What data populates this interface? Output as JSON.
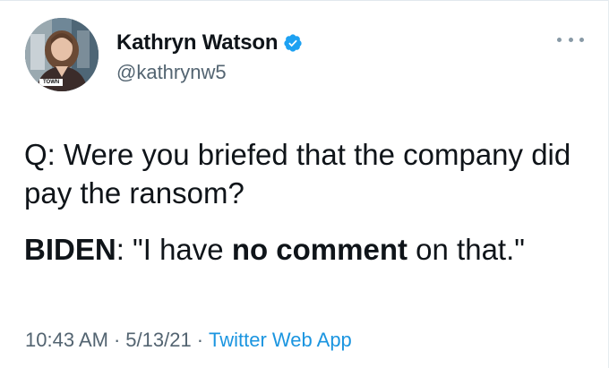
{
  "author": {
    "display_name": "Kathryn Watson",
    "handle": "@kathrynw5",
    "verified": true,
    "avatar_caption": "TOWN"
  },
  "tweet": {
    "line1": "Q: Were you briefed that the company did pay the ransom?",
    "line2_speaker": "BIDEN",
    "line2_colon": ":",
    "line2_pre": " \"I have ",
    "line2_bold": "no comment",
    "line2_post": " on that.\""
  },
  "meta": {
    "time": "10:43 AM",
    "separator": "·",
    "date": "5/13/21",
    "source": "Twitter Web App"
  },
  "colors": {
    "text": "#0f1419",
    "secondary": "#536471",
    "link": "#1b95e0",
    "verified": "#1da1f2"
  },
  "icons": {
    "verified": "verified-badge-icon",
    "more": "more-options-icon"
  }
}
